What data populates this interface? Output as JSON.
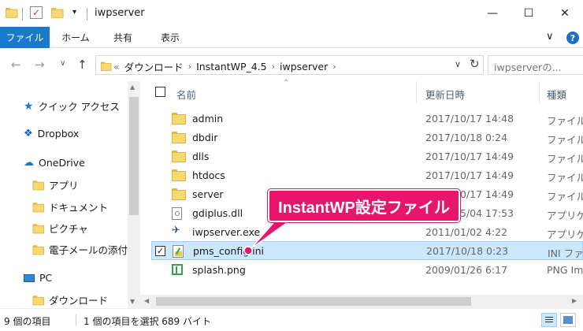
{
  "window": {
    "title": "iwpserver",
    "minimize_glyph": "—",
    "maximize_glyph": "☐",
    "close_glyph": "✕"
  },
  "ribbon": {
    "tabs": [
      "ファイル",
      "ホーム",
      "共有",
      "表示"
    ],
    "expand_glyph": "∨",
    "help_glyph": "?"
  },
  "address": {
    "back_glyph": "←",
    "forward_glyph": "→",
    "recent_glyph": "∨",
    "up_glyph": "↑",
    "prefix_glyph": "«",
    "crumbs": [
      "ダウンロード",
      "InstantWP_4.5",
      "iwpserver"
    ],
    "crumb_sep": "›",
    "dropdown_glyph": "∨",
    "refresh_glyph": "↻",
    "search_placeholder": "iwpserverの..."
  },
  "nav": {
    "quick_access": "クイック アクセス",
    "dropbox": "Dropbox",
    "onedrive": "OneDrive",
    "apps": "アプリ",
    "documents": "ドキュメント",
    "pictures": "ピクチャ",
    "email_attach": "電子メールの添付ファ",
    "pc": "PC",
    "downloads": "ダウンロード"
  },
  "columns": {
    "name": "名前",
    "date": "更新日時",
    "type": "種類"
  },
  "files": [
    {
      "name": "admin",
      "date": "2017/10/17 14:48",
      "type": "ファイル",
      "icon": "folder-icon"
    },
    {
      "name": "dbdir",
      "date": "2017/10/18 0:24",
      "type": "ファイル",
      "icon": "folder-icon"
    },
    {
      "name": "dlls",
      "date": "2017/10/17 14:49",
      "type": "ファイル",
      "icon": "folder-icon"
    },
    {
      "name": "htdocs",
      "date": "2017/10/17 14:49",
      "type": "ファイル",
      "icon": "folder-icon"
    },
    {
      "name": "server",
      "date": "2017/10/17 14:49",
      "type": "ファイル",
      "icon": "folder-icon"
    },
    {
      "name": "gdiplus.dll",
      "date": "2005/05/04 17:53",
      "type": "アプリケ",
      "icon": "dll-icon"
    },
    {
      "name": "iwpserver.exe",
      "date": "2011/01/02 4:22",
      "type": "アプリケ",
      "icon": "exe-icon"
    },
    {
      "name": "pms_config.ini",
      "date": "2017/10/18 0:23",
      "type": "INI ファ",
      "icon": "ini-icon"
    },
    {
      "name": "splash.png",
      "date": "2009/01/26 6:17",
      "type": "PNG Im",
      "icon": "image-icon"
    }
  ],
  "selected_index": 7,
  "status": {
    "count": "9 個の項目",
    "selection": "1 個の項目を選択  689 バイト"
  },
  "callout": {
    "text": "InstantWP設定ファイル",
    "color": "#e6166d"
  },
  "colors": {
    "accent": "#1979ca",
    "selection_bg": "#cce8ff",
    "selection_border": "#99d1ff",
    "folder": "#f8d775"
  }
}
